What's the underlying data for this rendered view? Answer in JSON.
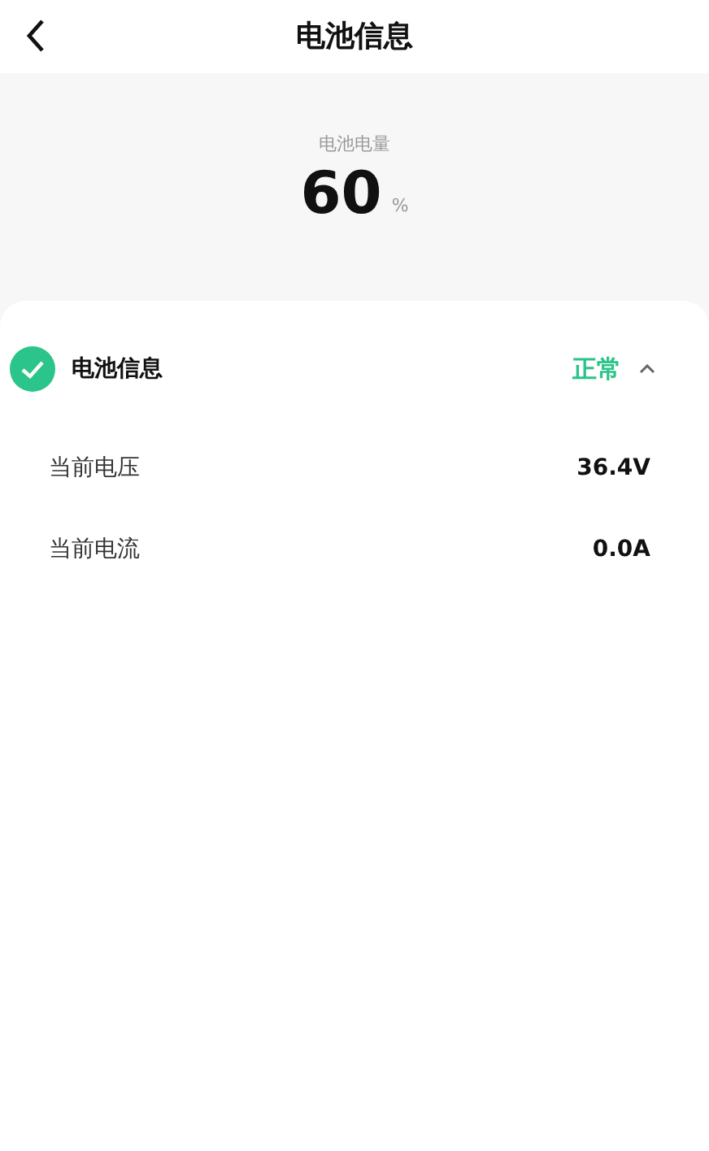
{
  "header": {
    "title": "电池信息"
  },
  "battery": {
    "label": "电池电量",
    "value": "60",
    "unit": "%"
  },
  "section": {
    "title": "电池信息",
    "status": "正常",
    "expanded": true,
    "rows": [
      {
        "label": "当前电压",
        "value": "36.4V"
      },
      {
        "label": "当前电流",
        "value": "0.0A"
      }
    ]
  }
}
